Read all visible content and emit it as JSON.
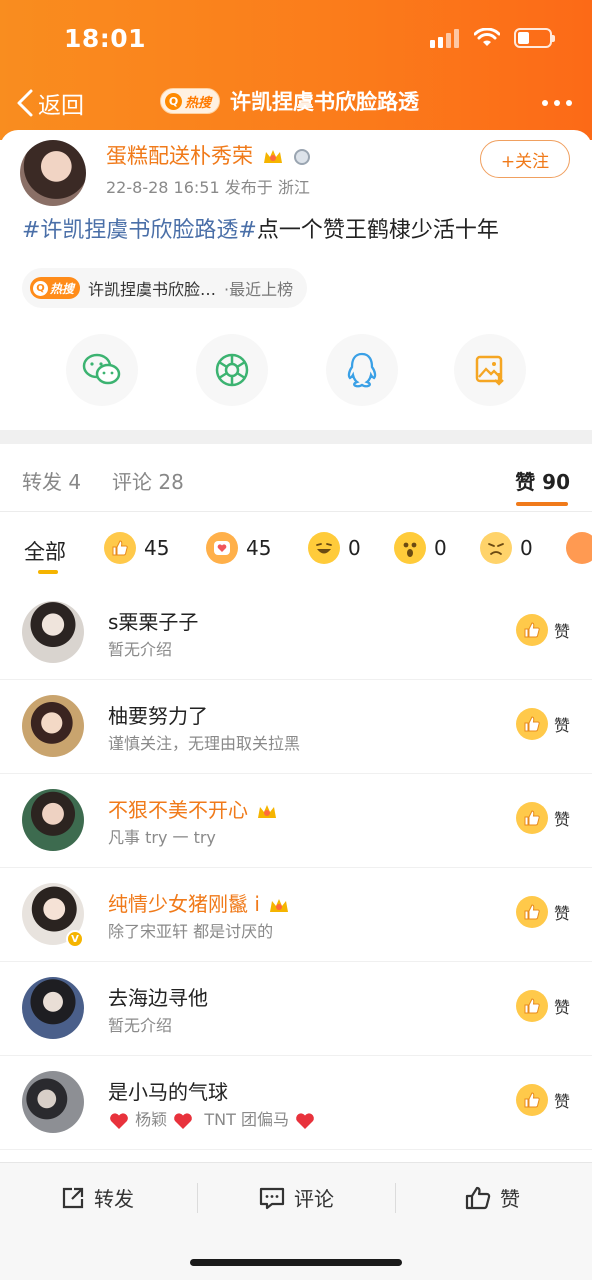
{
  "status_bar": {
    "time": "18:01",
    "battery_level": 0.35
  },
  "nav": {
    "back_label": "返回",
    "hot_badge": "热搜",
    "title": "许凯捏虞书欣脸路透"
  },
  "post": {
    "author_name": "蛋糕配送朴秀荣",
    "meta": "22-8-28 16:51  发布于 浙江",
    "follow_label": "+关注",
    "text_tag": "#许凯捏虞书欣脸路透#",
    "text_body": "点一个赞王鹤棣少活十年",
    "hot_chip_badge": "热搜",
    "hot_chip_text": "许凯捏虞书欣脸…",
    "hot_chip_sub": "·最近上榜",
    "share_icons": [
      "wechat-icon",
      "moments-icon",
      "qq-icon",
      "save-image-icon"
    ]
  },
  "tabs": [
    {
      "label": "转发",
      "count": "4"
    },
    {
      "label": "评论",
      "count": "28"
    },
    {
      "label": "赞",
      "count": "90"
    }
  ],
  "reactions": {
    "all_label": "全部",
    "items": [
      {
        "icon": "thumbs-up-emoji",
        "count": "45"
      },
      {
        "icon": "heart-emoji",
        "count": "45"
      },
      {
        "icon": "laugh-emoji",
        "count": "0"
      },
      {
        "icon": "surprised-emoji",
        "count": "0"
      },
      {
        "icon": "sad-emoji",
        "count": "0"
      }
    ]
  },
  "likers": [
    {
      "name": "s栗栗子子",
      "bio": "暂无介绍",
      "vip": false
    },
    {
      "name": "柚要努力了",
      "bio": "谨慎关注，无理由取关拉黑",
      "vip": false
    },
    {
      "name": "不狠不美不开心",
      "bio": "凡事 try 一 try",
      "vip": true
    },
    {
      "name": "纯情少女猪刚鬣 i",
      "bio": "除了宋亚轩 都是讨厌的",
      "vip": true
    },
    {
      "name": "去海边寻他",
      "bio": "暂无介绍",
      "vip": false
    },
    {
      "name": "是小马的气球",
      "bio_a": "杨颖",
      "bio_b": "TNT 团偏马",
      "vip": false
    }
  ],
  "like_label": "赞",
  "bottom_bar": {
    "repost": "转发",
    "comment": "评论",
    "like": "赞"
  },
  "colors": {
    "brand_orange": "#fb7d1b",
    "vip_name": "#f07a1a",
    "tag_blue": "#4a6fa8"
  }
}
